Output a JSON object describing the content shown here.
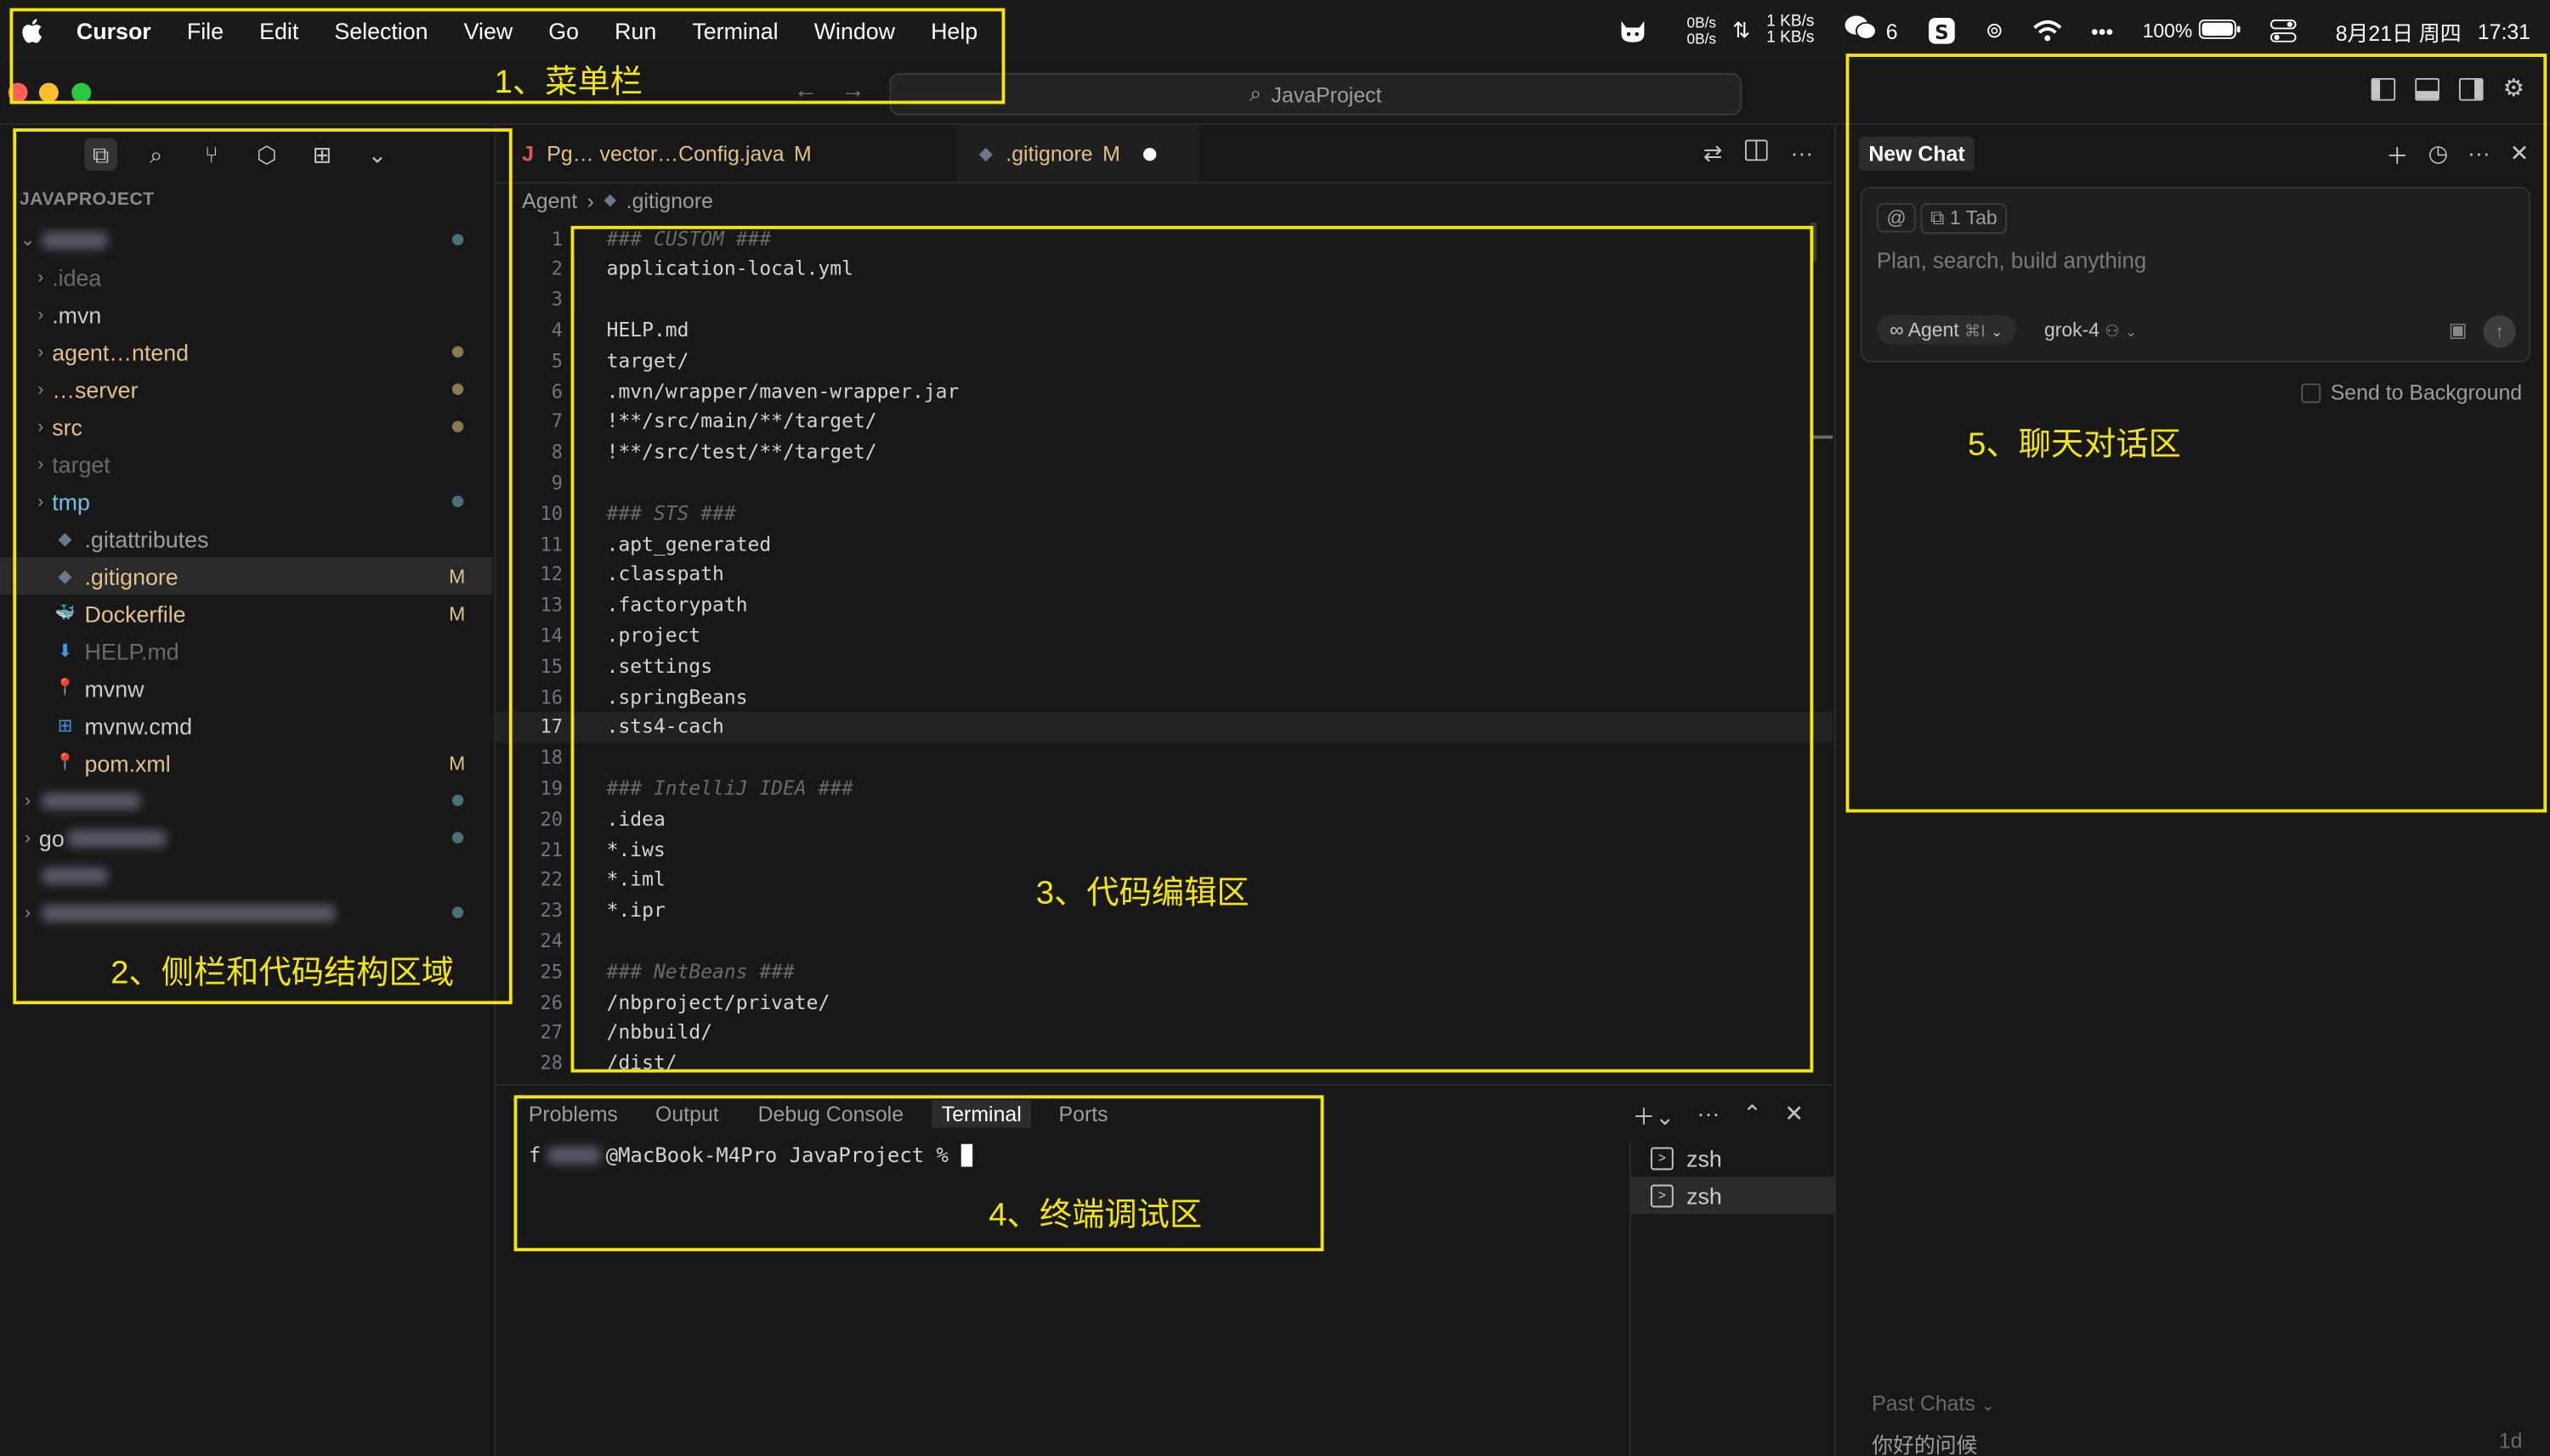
{
  "menubar": {
    "app": "Cursor",
    "items": [
      "File",
      "Edit",
      "Selection",
      "View",
      "Go",
      "Run",
      "Terminal",
      "Window",
      "Help"
    ],
    "status": {
      "net_up": "0B/s",
      "net_down": "0B/s",
      "net_up2": "1 KB/s",
      "net_down2": "1 KB/s",
      "wechat_count": "6",
      "battery": "100%",
      "date": "8月21日 周四",
      "time": "17:31"
    }
  },
  "titlebar": {
    "search": "JavaProject"
  },
  "sidebar": {
    "title": "JAVAPROJECT",
    "tree": [
      {
        "label": "",
        "blurred": true,
        "blur_w": 40,
        "expanded": true,
        "indent": 0,
        "status": "dot",
        "color": "#cccccc"
      },
      {
        "label": ".idea",
        "indent": 1,
        "folder": true,
        "color": "#6a6a6a"
      },
      {
        "label": ".mvn",
        "indent": 1,
        "folder": true,
        "color": "#cccccc"
      },
      {
        "label": "agent…ntend",
        "indent": 1,
        "folder": true,
        "color": "#e2c08d",
        "status": "dot-yellow"
      },
      {
        "label": "…server",
        "indent": 1,
        "folder": true,
        "color": "#e2c08d",
        "status": "dot-yellow"
      },
      {
        "label": "src",
        "indent": 1,
        "folder": true,
        "color": "#e2c08d",
        "status": "dot-yellow"
      },
      {
        "label": "target",
        "indent": 1,
        "folder": true,
        "color": "#6a6a6a"
      },
      {
        "label": "tmp",
        "indent": 1,
        "folder": true,
        "color": "#73c0e2",
        "status": "dot-teal"
      },
      {
        "label": ".gitattributes",
        "indent": 1,
        "icon": "git",
        "color": "#9d9d9d"
      },
      {
        "label": ".gitignore",
        "indent": 1,
        "icon": "git",
        "color": "#e2c08d",
        "badge": "M",
        "selected": true
      },
      {
        "label": "Dockerfile",
        "indent": 1,
        "icon": "docker",
        "color": "#e2c08d",
        "badge": "M"
      },
      {
        "label": "HELP.md",
        "indent": 1,
        "icon": "md",
        "color": "#6a6a6a"
      },
      {
        "label": "mvnw",
        "indent": 1,
        "icon": "pin",
        "color": "#cccccc"
      },
      {
        "label": "mvnw.cmd",
        "indent": 1,
        "icon": "win",
        "color": "#cccccc"
      },
      {
        "label": "pom.xml",
        "indent": 1,
        "icon": "pin",
        "color": "#e2c08d",
        "badge": "M"
      },
      {
        "label": "",
        "blurred": true,
        "blur_w": 60,
        "indent": 0,
        "folder": true,
        "status": "dot-teal"
      },
      {
        "label": "go",
        "blurred": true,
        "blur_w": 60,
        "indent": 0,
        "folder": true,
        "status": "dot-teal"
      },
      {
        "label": "",
        "blurred": true,
        "blur_w": 40,
        "indent": 0
      },
      {
        "label": "",
        "blurred": true,
        "blur_w": 180,
        "indent": 0,
        "folder": true,
        "status": "dot-teal"
      }
    ]
  },
  "tabs": {
    "tab1": {
      "label": "Pg… vector…Config.java",
      "mod": "M"
    },
    "tab2": {
      "label": ".gitignore",
      "mod": "M"
    }
  },
  "breadcrumb": {
    "root": "Agent",
    "file": ".gitignore"
  },
  "editor": {
    "current_line": 17,
    "lines": [
      {
        "n": "1",
        "text": "### CUSTOM ###",
        "comment": true
      },
      {
        "n": "2",
        "text": "application-local.yml"
      },
      {
        "n": "3",
        "text": ""
      },
      {
        "n": "4",
        "text": "HELP.md"
      },
      {
        "n": "5",
        "text": "target/"
      },
      {
        "n": "6",
        "text": ".mvn/wrapper/maven-wrapper.jar"
      },
      {
        "n": "7",
        "text": "!**/src/main/**/target/"
      },
      {
        "n": "8",
        "text": "!**/src/test/**/target/"
      },
      {
        "n": "9",
        "text": ""
      },
      {
        "n": "10",
        "text": "### STS ###",
        "comment": true
      },
      {
        "n": "11",
        "text": ".apt_generated"
      },
      {
        "n": "12",
        "text": ".classpath"
      },
      {
        "n": "13",
        "text": ".factorypath"
      },
      {
        "n": "14",
        "text": ".project"
      },
      {
        "n": "15",
        "text": ".settings"
      },
      {
        "n": "16",
        "text": ".springBeans"
      },
      {
        "n": "17",
        "text": ".sts4-cach"
      },
      {
        "n": "18",
        "text": ""
      },
      {
        "n": "19",
        "text": "### IntelliJ IDEA ###",
        "comment": true
      },
      {
        "n": "20",
        "text": ".idea"
      },
      {
        "n": "21",
        "text": "*.iws"
      },
      {
        "n": "22",
        "text": "*.iml"
      },
      {
        "n": "23",
        "text": "*.ipr"
      },
      {
        "n": "24",
        "text": ""
      },
      {
        "n": "25",
        "text": "### NetBeans ###",
        "comment": true
      },
      {
        "n": "26",
        "text": "/nbproject/private/"
      },
      {
        "n": "27",
        "text": "/nbbuild/"
      },
      {
        "n": "28",
        "text": "/dist/"
      }
    ]
  },
  "panel": {
    "tabs": [
      "Problems",
      "Output",
      "Debug Console",
      "Terminal",
      "Ports"
    ],
    "active_tab": "Terminal",
    "prompt": "@MacBook-M4Pro JavaProject % ",
    "terminals": [
      "zsh",
      "zsh"
    ]
  },
  "chat": {
    "tab": "New Chat",
    "mention": "@",
    "context_chip": "1 Tab",
    "placeholder": "Plan, search, build anything",
    "agent": "Agent",
    "agent_shortcut": "⌘I",
    "model": "grok-4",
    "send_bg": "Send to Background",
    "past_chats": "Past Chats",
    "past_item": "你好的问候",
    "past_age": "1d"
  },
  "annotations": {
    "a1": "1、菜单栏",
    "a2": "2、侧栏和代码结构区域",
    "a3": "3、代码编辑区",
    "a4": "4、终端调试区",
    "a5": "5、聊天对话区"
  },
  "colors": {
    "annotation": "#f2e60c",
    "modified": "#e2c08d",
    "background": "#181818"
  }
}
